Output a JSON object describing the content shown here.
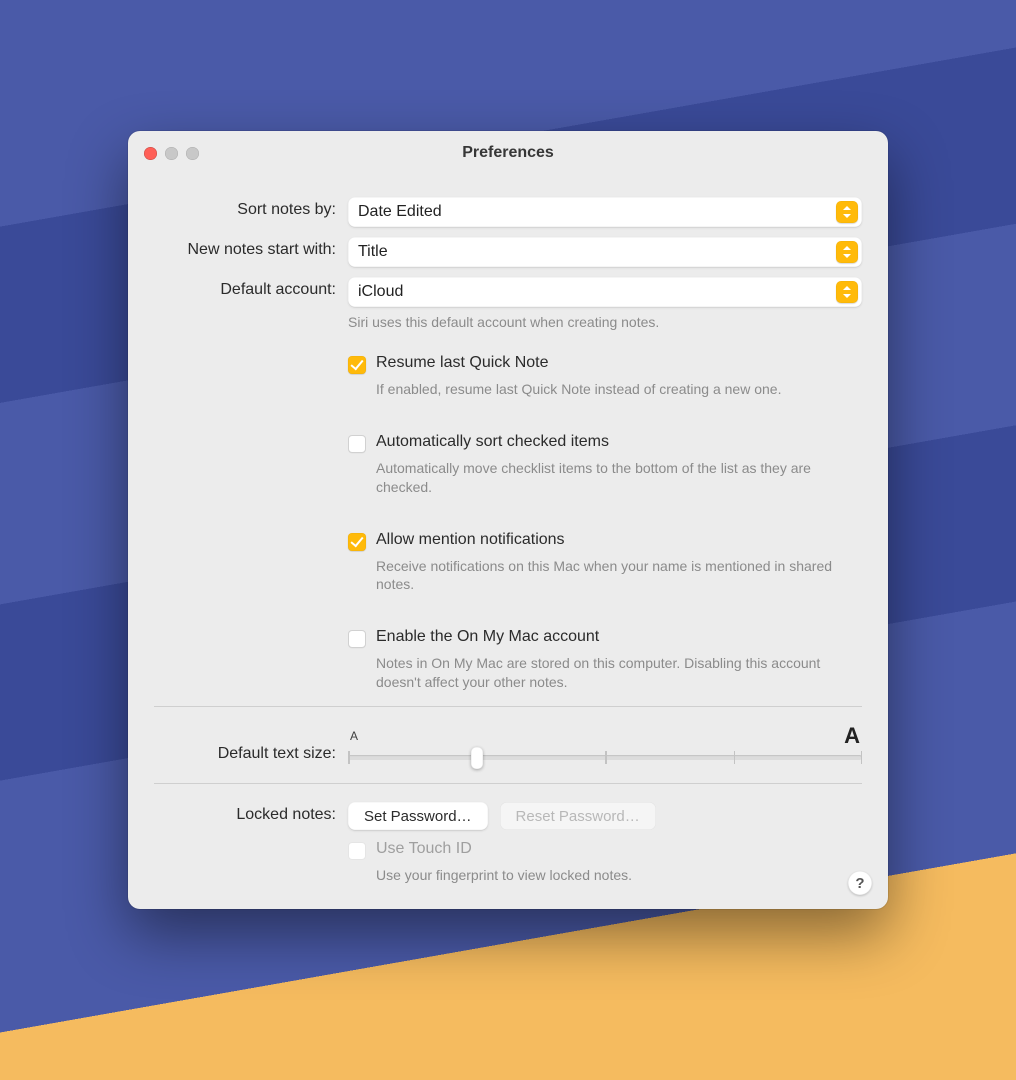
{
  "window": {
    "title": "Preferences"
  },
  "rows": {
    "sort": {
      "label": "Sort notes by:",
      "value": "Date Edited"
    },
    "newnotes": {
      "label": "New notes start with:",
      "value": "Title"
    },
    "account": {
      "label": "Default account:",
      "value": "iCloud",
      "help": "Siri uses this default account when creating notes."
    }
  },
  "checks": {
    "resume": {
      "label": "Resume last Quick Note",
      "help": "If enabled, resume last Quick Note instead of creating a new one.",
      "checked": true
    },
    "autosort": {
      "label": "Automatically sort checked items",
      "help": "Automatically move checklist items to the bottom of the list as they are checked.",
      "checked": false
    },
    "mentions": {
      "label": "Allow mention notifications",
      "help": "Receive notifications on this Mac when your name is mentioned in shared notes.",
      "checked": true
    },
    "onmymac": {
      "label": "Enable the On My Mac account",
      "help": "Notes in On My Mac are stored on this computer. Disabling this account doesn't affect your other notes.",
      "checked": false
    }
  },
  "textsize": {
    "label": "Default text size:",
    "small_glyph": "A",
    "big_glyph": "A",
    "ticks": 5,
    "value_index": 1
  },
  "locked": {
    "label": "Locked notes:",
    "set_btn": "Set Password…",
    "reset_btn": "Reset Password…",
    "touchid_label": "Use Touch ID",
    "touchid_help": "Use your fingerprint to view locked notes."
  },
  "help_btn": "?"
}
